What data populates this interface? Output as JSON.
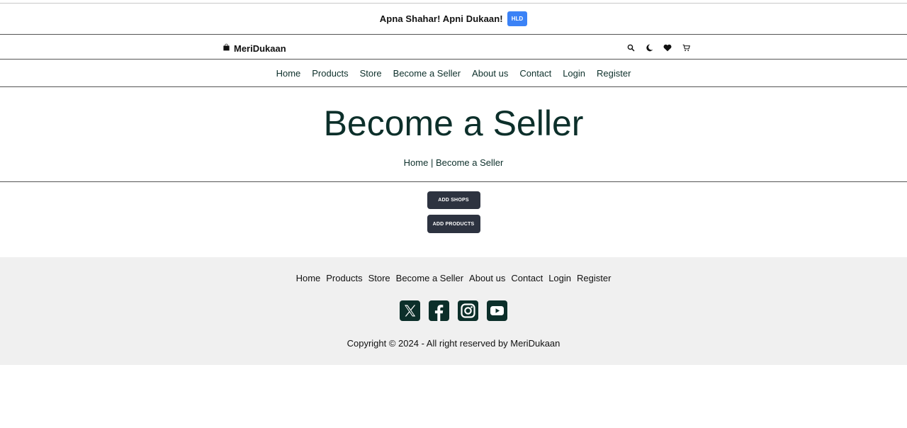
{
  "announcement": {
    "text": "Apna Shahar! Apni Dukaan!",
    "badge": "HLD"
  },
  "brand": {
    "name": "MeriDukaan",
    "icon": "shopping-bag-icon"
  },
  "header_icons": [
    "search-icon",
    "moon-icon",
    "heart-icon",
    "cart-icon"
  ],
  "nav": {
    "items": [
      {
        "label": "Home"
      },
      {
        "label": "Products"
      },
      {
        "label": "Store"
      },
      {
        "label": "Become a Seller"
      },
      {
        "label": "About us"
      },
      {
        "label": "Contact"
      },
      {
        "label": "Login"
      },
      {
        "label": "Register"
      }
    ]
  },
  "hero": {
    "title": "Become a Seller",
    "breadcrumb": {
      "home": "Home",
      "separator": " | ",
      "current": "Become a Seller"
    }
  },
  "actions": {
    "add_shops": "ADD SHOPS",
    "add_products": "ADD PRODUCTS"
  },
  "footer": {
    "nav": [
      {
        "label": "Home"
      },
      {
        "label": "Products"
      },
      {
        "label": "Store"
      },
      {
        "label": "Become a Seller"
      },
      {
        "label": "About us"
      },
      {
        "label": "Contact"
      },
      {
        "label": "Login"
      },
      {
        "label": "Register"
      }
    ],
    "socials": [
      "x-twitter-icon",
      "facebook-icon",
      "instagram-icon",
      "youtube-icon"
    ],
    "copyright": "Copyright © 2024 - All right reserved by MeriDukaan"
  },
  "colors": {
    "primary_text": "#0c2f2a",
    "badge": "#3b82f6",
    "button": "#2d3340",
    "footer_bg": "#f0f0f0"
  }
}
